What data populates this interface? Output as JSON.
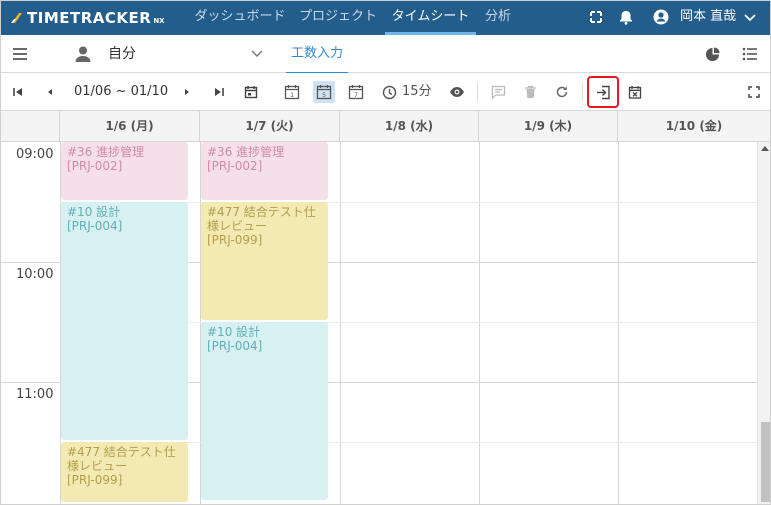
{
  "app": {
    "logo_text": "TIMETRACKER",
    "logo_sub": "NX"
  },
  "topnav": {
    "tabs": [
      {
        "label": "ダッシュボード",
        "active": false
      },
      {
        "label": "プロジェクト",
        "active": false
      },
      {
        "label": "タイムシート",
        "active": true
      },
      {
        "label": "分析",
        "active": false
      }
    ],
    "user_name": "岡本 直哉"
  },
  "subbar": {
    "user_select": "自分",
    "tab_label": "工数入力"
  },
  "toolbar": {
    "date_range": "01/06 ~ 01/10",
    "interval": "15分"
  },
  "calendar": {
    "columns": [
      "1/6 (月)",
      "1/7 (火)",
      "1/8 (水)",
      "1/9 (木)",
      "1/10 (金)"
    ],
    "times": [
      "09:00",
      "10:00",
      "11:00"
    ],
    "events": {
      "e1": {
        "title": "#36 進捗管理",
        "project": "[PRJ-002]"
      },
      "e2": {
        "title": "#10 設計",
        "project": "[PRJ-004]"
      },
      "e3": {
        "title": "#477 結合テスト仕様レビュー",
        "project": "[PRJ-099]"
      },
      "e4": {
        "title": "#36 進捗管理",
        "project": "[PRJ-002]"
      },
      "e5": {
        "title": "#477 結合テスト仕様レビュー",
        "project": "[PRJ-099]"
      },
      "e6": {
        "title": "#10 設計",
        "project": "[PRJ-004]"
      }
    }
  },
  "colors": {
    "nav": "#235d8c",
    "accent": "#2f8bd0",
    "highlight": "#e5191f",
    "event_pink": "#f5e0ea",
    "event_cyan": "#d7f1f3",
    "event_yellow": "#f2eab2"
  },
  "icons": [
    "menu-icon",
    "person-icon",
    "chevron-down-icon",
    "pie-chart-icon",
    "list-icon",
    "first-page-icon",
    "prev-icon",
    "next-icon",
    "last-page-icon",
    "calendar-icon",
    "day-view-icon",
    "five-day-view-icon",
    "week-view-icon",
    "clock-icon",
    "eye-icon",
    "comment-icon",
    "delete-icon",
    "refresh-icon",
    "import-icon",
    "clear-calendar-icon",
    "fullscreen-icon",
    "bell-icon",
    "account-icon"
  ]
}
